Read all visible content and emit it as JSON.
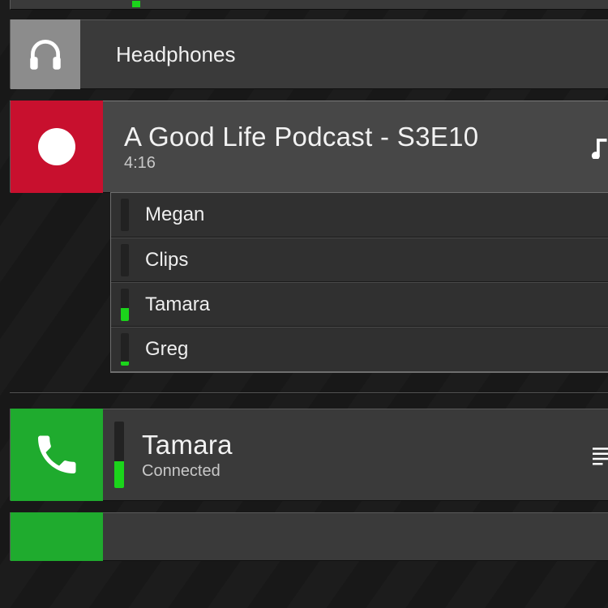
{
  "top_stub": {
    "level": 0.1
  },
  "headphones": {
    "label": "Headphones"
  },
  "recording": {
    "title": "A Good Life Podcast - S3E10",
    "time": "4:16",
    "tracks": [
      {
        "name": "Megan",
        "level": 0.0
      },
      {
        "name": "Clips",
        "level": 0.0
      },
      {
        "name": "Tamara",
        "level": 0.4
      },
      {
        "name": "Greg",
        "level": 0.1
      }
    ]
  },
  "caller": {
    "name": "Tamara",
    "status": "Connected",
    "level": 0.4
  }
}
